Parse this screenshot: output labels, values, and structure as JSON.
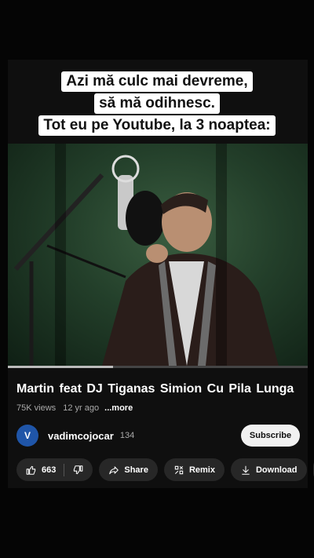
{
  "caption": {
    "line1": "Azi mă culc mai devreme,",
    "line2": "să mă odihnesc.",
    "line3": "Tot eu pe Youtube, la 3 noaptea:"
  },
  "video": {
    "title": "Martin feat  DJ Tiganas   Simion Cu Pila Lunga",
    "views": "75K views",
    "age": "12 yr ago",
    "more": "...more",
    "progress": 0.35
  },
  "channel": {
    "avatar_letter": "V",
    "name": "vadimcojocar",
    "subscribers": "134",
    "subscribe_label": "Subscribe"
  },
  "actions": {
    "likes": "663",
    "share": "Share",
    "remix": "Remix",
    "download": "Download"
  },
  "colors": {
    "background": "#000000",
    "pill": "#272727",
    "subscribe_bg": "#f1f1f1",
    "avatar": "#1f55a8"
  }
}
